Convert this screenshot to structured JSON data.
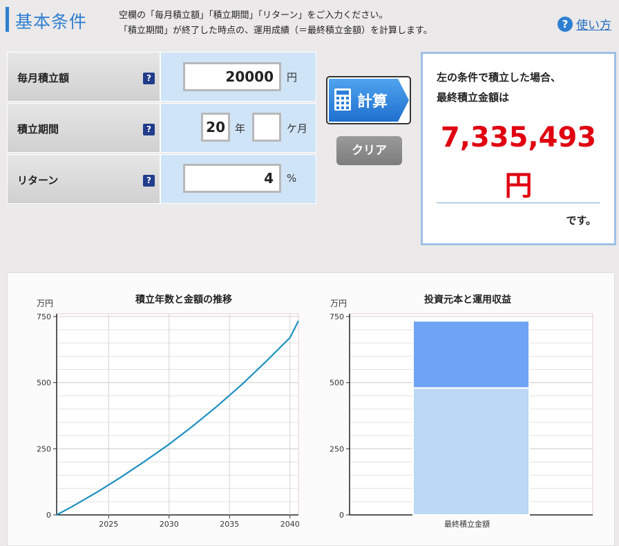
{
  "header": {
    "title": "基本条件",
    "desc_line1": "空欄の「毎月積立額」「積立期間」「リターン」をご入力ください。",
    "desc_line2": "「積立期間」が終了した時点の、運用成績（＝最終積立金額）を計算します。",
    "help_label": "使い方",
    "help_icon": "?"
  },
  "form": {
    "monthly": {
      "label": "毎月積立額",
      "value": "20000",
      "unit": "円"
    },
    "period": {
      "label": "積立期間",
      "years": "20",
      "years_unit": "年",
      "months": "",
      "months_unit": "ケ月"
    },
    "return": {
      "label": "リターン",
      "value": "4",
      "unit": "%"
    },
    "help_glyph": "?"
  },
  "buttons": {
    "calc": "計算",
    "clear": "クリア"
  },
  "result": {
    "line1": "左の条件で積立した場合、",
    "line2": "最終積立金額は",
    "amount": "7,335,493",
    "unit": "円",
    "suffix": "です。"
  },
  "colors": {
    "accent": "#2f7fd0",
    "result_red": "#e00010",
    "line": "#1c8fc0",
    "bar_principal": "#bdd8f4",
    "bar_gain": "#6fa3f4"
  },
  "chart_data": [
    {
      "type": "line",
      "title": "積立年数と金額の推移",
      "ylabel": "万円",
      "ylim": [
        0,
        750
      ],
      "yticks": [
        "0",
        "250",
        "500",
        "750"
      ],
      "xticks": [
        "2025",
        "2030",
        "2035",
        "2040"
      ],
      "xlim": [
        2020.7,
        2040.7
      ],
      "x": [
        2020.7,
        2022,
        2024,
        2026,
        2028,
        2030,
        2032,
        2034,
        2036,
        2038,
        2040,
        2040.7
      ],
      "y": [
        0,
        32,
        85,
        142,
        203,
        267,
        337,
        412,
        492,
        579,
        670,
        733.5
      ],
      "grid": true
    },
    {
      "type": "bar",
      "title": "投資元本と運用収益",
      "ylabel": "万円",
      "ylim": [
        0,
        750
      ],
      "yticks": [
        "0",
        "250",
        "500",
        "750"
      ],
      "categories": [
        "最終積立金額"
      ],
      "series": [
        {
          "values": [
            480
          ]
        },
        {
          "values": [
            253.5
          ]
        }
      ],
      "stacked": true,
      "grid": true
    }
  ]
}
